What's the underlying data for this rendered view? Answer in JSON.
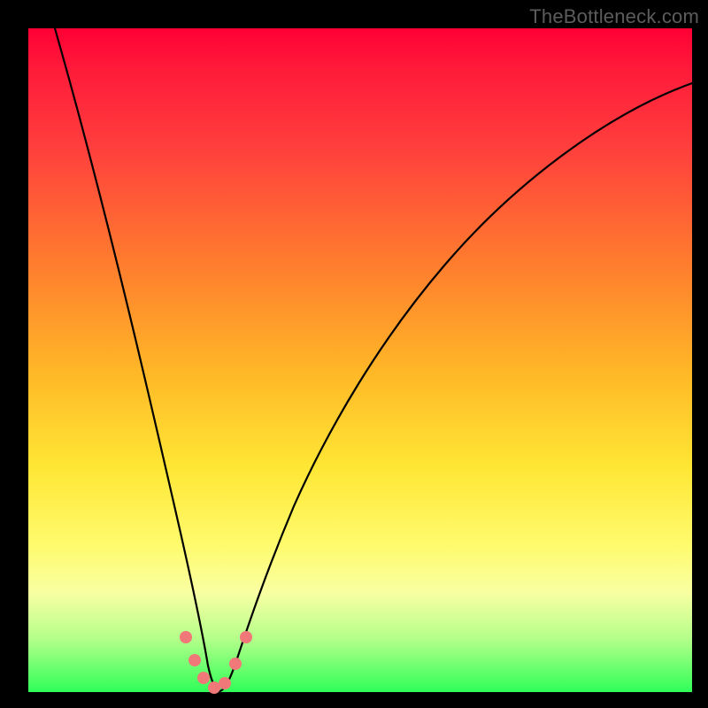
{
  "watermark": "TheBottleneck.com",
  "colors": {
    "frame": "#000000",
    "gradient_top": "#ff0034",
    "gradient_bottom": "#2fff58",
    "curve": "#000000",
    "marker": "#f07878"
  },
  "chart_data": {
    "type": "line",
    "title": "",
    "xlabel": "",
    "ylabel": "",
    "xlim": [
      0,
      100
    ],
    "ylim": [
      0,
      100
    ],
    "notes": "No axes or tick labels rendered. Vertical rainbow gradient background (red top → green bottom). Black V-shaped bottleneck curve with minimum near x≈27. Pink dot markers cluster at the trough.",
    "series": [
      {
        "name": "bottleneck-curve",
        "x": [
          4,
          8,
          12,
          16,
          20,
          23,
          25,
          27,
          29,
          31,
          33,
          36,
          40,
          46,
          54,
          64,
          76,
          90,
          100
        ],
        "y": [
          100,
          80,
          60,
          40,
          22,
          10,
          4,
          0,
          2,
          6,
          12,
          20,
          30,
          42,
          55,
          68,
          78,
          86,
          90
        ]
      }
    ],
    "markers": {
      "name": "trough-markers",
      "x": [
        22.5,
        24,
        25.5,
        27,
        28.5,
        30.5,
        32
      ],
      "y": [
        9,
        5,
        2,
        0.5,
        1.5,
        5,
        9
      ]
    }
  }
}
